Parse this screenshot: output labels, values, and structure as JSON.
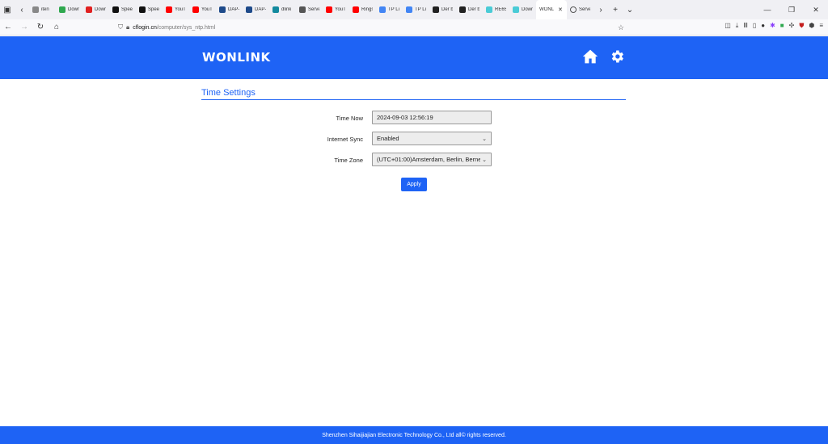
{
  "browser": {
    "tabs": [
      {
        "title": "iten",
        "color": "#888888",
        "icon": "page-icon"
      },
      {
        "title": "Down",
        "color": "#2fa84f",
        "icon": "shield-icon"
      },
      {
        "title": "Down",
        "color": "#e02020",
        "icon": "opera-icon"
      },
      {
        "title": "Speed",
        "color": "#111111",
        "icon": "speedtest-icon"
      },
      {
        "title": "Speed",
        "color": "#111111",
        "icon": "speedtest-icon"
      },
      {
        "title": "YouTu",
        "color": "#ff0000",
        "icon": "youtube-icon"
      },
      {
        "title": "YouTu",
        "color": "#ff0000",
        "icon": "youtube-icon"
      },
      {
        "title": "DAP-",
        "color": "#1e4a8a",
        "icon": "dlink-icon"
      },
      {
        "title": "DAP-",
        "color": "#1e4a8a",
        "icon": "dlink-icon"
      },
      {
        "title": "dlink",
        "color": "#138a9e",
        "icon": "dlink-icon"
      },
      {
        "title": "Server",
        "color": "#555555",
        "icon": "info-icon"
      },
      {
        "title": "YouTu",
        "color": "#ff0000",
        "icon": "youtube-icon"
      },
      {
        "title": "Rings",
        "color": "#ff0000",
        "icon": "youtube-icon"
      },
      {
        "title": "TP Lin",
        "color": "#4285f4",
        "icon": "google-icon"
      },
      {
        "title": "TP Lin",
        "color": "#4285f4",
        "icon": "google-icon"
      },
      {
        "title": "Der be",
        "color": "#222222",
        "icon": "page-icon"
      },
      {
        "title": "Der be",
        "color": "#222222",
        "icon": "page-icon"
      },
      {
        "title": "RE655",
        "color": "#4acbd6",
        "icon": "tplink-icon"
      },
      {
        "title": "Down",
        "color": "#4acbd6",
        "icon": "tplink-icon"
      }
    ],
    "active_tab": {
      "title": "WONL"
    },
    "after_tabs": [
      {
        "title": "Serve"
      }
    ],
    "url_host": "cflogin.cn",
    "url_path": "/computer/sys_ntp.html"
  },
  "header": {
    "logo": "WONLINK",
    "accent": "#1e63f5"
  },
  "page": {
    "title": "Time Settings",
    "time_now_label": "Time Now",
    "time_now_value": "2024-09-03 12:56:19",
    "internet_sync_label": "Internet Sync",
    "internet_sync_value": "Enabled",
    "time_zone_label": "Time Zone",
    "time_zone_value": "(UTC+01:00)Amsterdam, Berlin, Berne,",
    "apply_label": "Apply"
  },
  "footer": {
    "text": "Shenzhen Sihaijiajian Electronic Technology Co., Ltd all© rights reserved."
  }
}
